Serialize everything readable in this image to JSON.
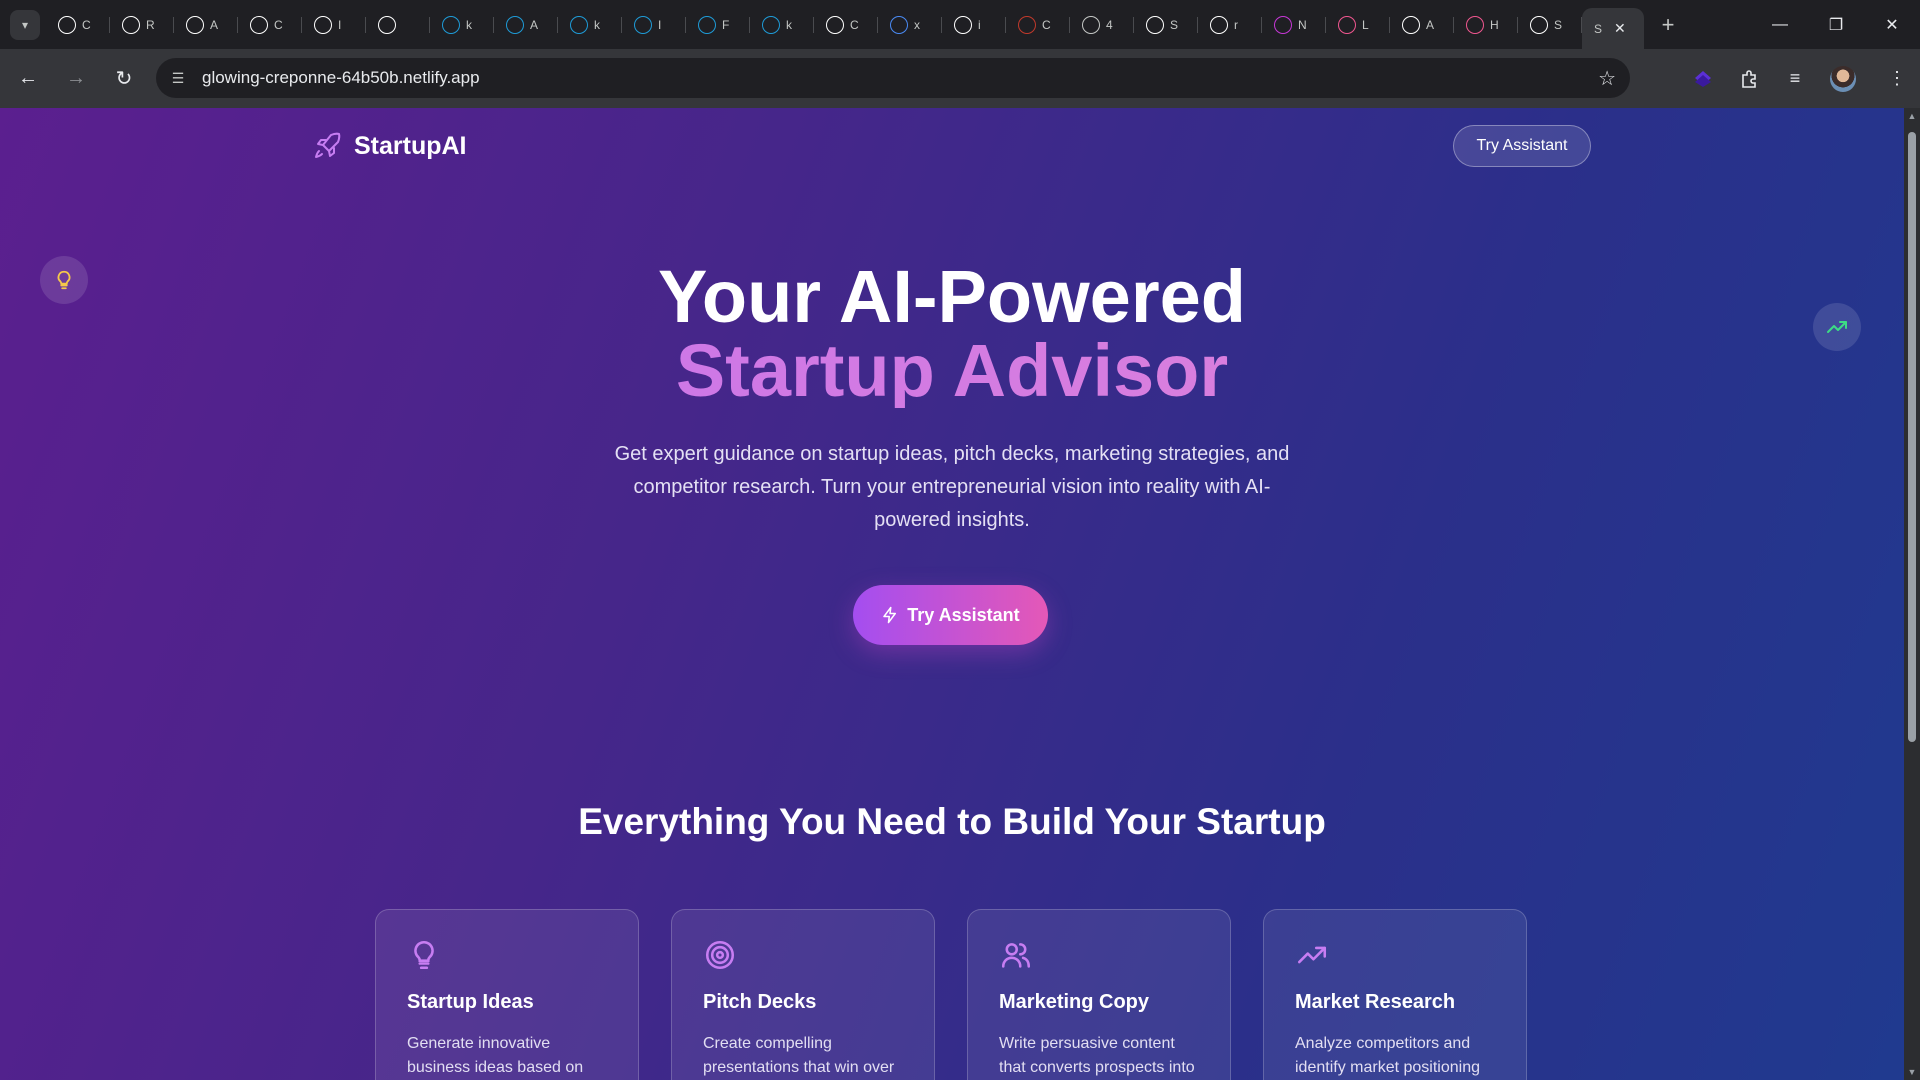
{
  "browser": {
    "tabs": [
      {
        "letter": "C",
        "icon": "github-icon",
        "color": "#ffffff"
      },
      {
        "letter": "R",
        "icon": "openai-icon",
        "color": "#ffffff"
      },
      {
        "letter": "A",
        "icon": "openai-icon",
        "color": "#ffffff"
      },
      {
        "letter": "C",
        "icon": "openai-icon",
        "color": "#ffffff"
      },
      {
        "letter": "I",
        "icon": "triangle-logo-icon",
        "color": "#ffffff"
      },
      {
        "letter": "",
        "icon": "speaker-icon",
        "color": "#ffffff"
      },
      {
        "letter": "k",
        "icon": "k-logo-icon",
        "color": "#1e9bd7"
      },
      {
        "letter": "A",
        "icon": "k-logo-icon",
        "color": "#1e9bd7"
      },
      {
        "letter": "k",
        "icon": "k-logo-icon",
        "color": "#1e9bd7"
      },
      {
        "letter": "I",
        "icon": "k-logo-icon",
        "color": "#1e9bd7"
      },
      {
        "letter": "F",
        "icon": "k-logo-icon",
        "color": "#1e9bd7"
      },
      {
        "letter": "k",
        "icon": "k-logo-icon",
        "color": "#1e9bd7"
      },
      {
        "letter": "C",
        "icon": "square-app-icon",
        "color": "#ffffff"
      },
      {
        "letter": "x",
        "icon": "docs-icon",
        "color": "#4a8af4"
      },
      {
        "letter": "i",
        "icon": "google-icon",
        "color": "#ffffff"
      },
      {
        "letter": "C",
        "icon": "shield-app-icon",
        "color": "#c0392b"
      },
      {
        "letter": "4",
        "icon": "globe-icon",
        "color": "#c4c7c5"
      },
      {
        "letter": "S",
        "icon": "n-logo-icon",
        "color": "#ffffff"
      },
      {
        "letter": "r",
        "icon": "google-icon",
        "color": "#ffffff"
      },
      {
        "letter": "N",
        "icon": "m-logo-icon",
        "color": "#c637d6"
      },
      {
        "letter": "L",
        "icon": "heart-app-icon",
        "color": "#f0568f"
      },
      {
        "letter": "A",
        "icon": "github-icon",
        "color": "#ffffff"
      },
      {
        "letter": "H",
        "icon": "heart-app-icon",
        "color": "#f0568f"
      },
      {
        "letter": "S",
        "icon": "b-logo-icon",
        "color": "#ffffff"
      }
    ],
    "active_tab_letter": "S",
    "url": "glowing-creponne-64b50b.netlify.app"
  },
  "page": {
    "brand": "StartupAI",
    "nav_button": "Try Assistant",
    "hero_line1": "Your AI-Powered",
    "hero_line2": "Startup Advisor",
    "hero_sub": "Get expert guidance on startup ideas, pitch decks, marketing strategies, and competitor research. Turn your entrepreneurial vision into reality with AI-powered insights.",
    "cta": "Try Assistant",
    "section_title": "Everything You Need to Build Your Startup",
    "cards": [
      {
        "title": "Startup Ideas",
        "desc": "Generate innovative business ideas based on",
        "icon": "lightbulb-icon"
      },
      {
        "title": "Pitch Decks",
        "desc": "Create compelling presentations that win over",
        "icon": "target-icon"
      },
      {
        "title": "Marketing Copy",
        "desc": "Write persuasive content that converts prospects into",
        "icon": "users-icon"
      },
      {
        "title": "Market Research",
        "desc": "Analyze competitors and identify market positioning",
        "icon": "trending-up-icon"
      }
    ]
  },
  "colors": {
    "accent_purple": "#c16ff0",
    "accent_pink": "#e458b7",
    "bulb_yellow": "#f5c84a",
    "trend_green": "#3ddc84"
  }
}
